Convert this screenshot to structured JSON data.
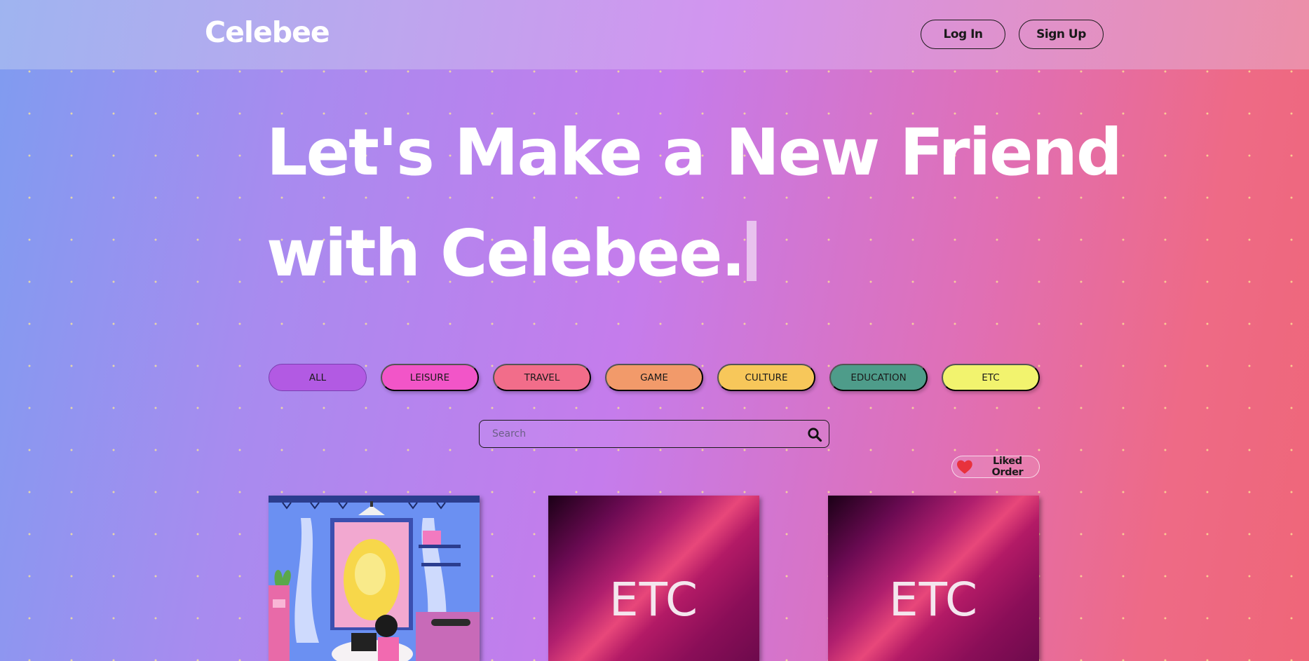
{
  "header": {
    "logo": "Celebee",
    "login_label": "Log In",
    "signup_label": "Sign Up"
  },
  "hero": {
    "line1": "Let's Make a New Friend",
    "line2": "with Celebee."
  },
  "categories": [
    {
      "label": "ALL",
      "color": "#b25ae3",
      "active": true
    },
    {
      "label": "LEISURE",
      "color": "#f255c8"
    },
    {
      "label": "TRAVEL",
      "color": "#f26d8a"
    },
    {
      "label": "GAME",
      "color": "#f29a6a"
    },
    {
      "label": "CULTURE",
      "color": "#f7c75a"
    },
    {
      "label": "EDUCATION",
      "color": "#4e9c8a"
    },
    {
      "label": "ETC",
      "color": "#f2f36e"
    }
  ],
  "search": {
    "placeholder": "Search",
    "icon": "search-icon"
  },
  "sort": {
    "label": "Liked Order",
    "icon": "heart-icon"
  },
  "cards": [
    {
      "label": "",
      "type": "illustration"
    },
    {
      "label": "ETC",
      "type": "placeholder"
    },
    {
      "label": "ETC",
      "type": "placeholder"
    }
  ],
  "colors": {
    "heart": "#e8323c",
    "text_dark": "#1a1a1a"
  }
}
